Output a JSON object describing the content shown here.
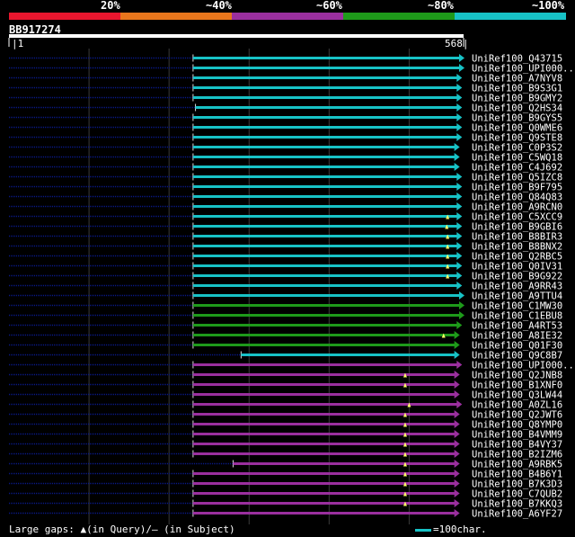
{
  "legend": {
    "labels": [
      "20%",
      "~40%",
      "~60%",
      "~80%",
      "~100%"
    ],
    "colors": [
      "#e8162e",
      "#e8761c",
      "#9a2f9e",
      "#1e9a1a",
      "#17c2c6"
    ]
  },
  "query": {
    "id": "BB917274",
    "start": "|1",
    "end": "568|",
    "length": 568
  },
  "footer": {
    "gaps_text": "Large gaps: ▲(in Query)/– (in Subject)",
    "scale_text": "=100char."
  },
  "colors": {
    "bg": "#000000",
    "query_bar": "#ffffff",
    "dotted_left": "#0a1a8a",
    "grid": "#3a3a3a",
    "cyan": "#17c2c6",
    "green": "#1e9a1a",
    "purple": "#9a2f9e",
    "gap_marker": "#ffff66"
  },
  "hits": [
    {
      "name": "UniRef100_Q43715",
      "color": "cyan",
      "start": 230,
      "end": 568,
      "gap": null
    },
    {
      "name": "UniRef100_UPI000..",
      "color": "cyan",
      "start": 230,
      "end": 568,
      "gap": null
    },
    {
      "name": "UniRef100_A7NYV8",
      "color": "cyan",
      "start": 230,
      "end": 565,
      "gap": null
    },
    {
      "name": "UniRef100_B9S3G1",
      "color": "cyan",
      "start": 230,
      "end": 565,
      "gap": null
    },
    {
      "name": "UniRef100_B9GMY2",
      "color": "cyan",
      "start": 230,
      "end": 565,
      "gap": null
    },
    {
      "name": "UniRef100_Q2HS34",
      "color": "cyan",
      "start": 233,
      "end": 565,
      "gap": null
    },
    {
      "name": "UniRef100_B9GYS5",
      "color": "cyan",
      "start": 230,
      "end": 565,
      "gap": null
    },
    {
      "name": "UniRef100_Q0WME6",
      "color": "cyan",
      "start": 230,
      "end": 565,
      "gap": null
    },
    {
      "name": "UniRef100_Q9STE8",
      "color": "cyan",
      "start": 230,
      "end": 565,
      "gap": null
    },
    {
      "name": "UniRef100_C0P3S2",
      "color": "cyan",
      "start": 230,
      "end": 562,
      "gap": null
    },
    {
      "name": "UniRef100_C5WQ18",
      "color": "cyan",
      "start": 230,
      "end": 562,
      "gap": null
    },
    {
      "name": "UniRef100_C4J692",
      "color": "cyan",
      "start": 230,
      "end": 562,
      "gap": null
    },
    {
      "name": "UniRef100_Q5IZC8",
      "color": "cyan",
      "start": 230,
      "end": 565,
      "gap": null
    },
    {
      "name": "UniRef100_B9F795",
      "color": "cyan",
      "start": 230,
      "end": 565,
      "gap": null
    },
    {
      "name": "UniRef100_Q84Q83",
      "color": "cyan",
      "start": 230,
      "end": 565,
      "gap": null
    },
    {
      "name": "UniRef100_A9RCN0",
      "color": "cyan",
      "start": 230,
      "end": 565,
      "gap": null
    },
    {
      "name": "UniRef100_C5XCC9",
      "color": "cyan",
      "start": 230,
      "end": 565,
      "gap": 548
    },
    {
      "name": "UniRef100_B9GBI6",
      "color": "cyan",
      "start": 230,
      "end": 565,
      "gap": 547
    },
    {
      "name": "UniRef100_B8BIR3",
      "color": "cyan",
      "start": 230,
      "end": 565,
      "gap": 548
    },
    {
      "name": "UniRef100_B8BNX2",
      "color": "cyan",
      "start": 230,
      "end": 565,
      "gap": 548
    },
    {
      "name": "UniRef100_Q2RBC5",
      "color": "cyan",
      "start": 230,
      "end": 565,
      "gap": 548
    },
    {
      "name": "UniRef100_Q0IV31",
      "color": "cyan",
      "start": 230,
      "end": 565,
      "gap": 548
    },
    {
      "name": "UniRef100_B9G922",
      "color": "cyan",
      "start": 230,
      "end": 565,
      "gap": 548
    },
    {
      "name": "UniRef100_A9RR43",
      "color": "cyan",
      "start": 230,
      "end": 565,
      "gap": null
    },
    {
      "name": "UniRef100_A9TTU4",
      "color": "cyan",
      "start": 230,
      "end": 568,
      "gap": null
    },
    {
      "name": "UniRef100_C1MW30",
      "color": "green",
      "start": 230,
      "end": 568,
      "gap": null
    },
    {
      "name": "UniRef100_C1EBU8",
      "color": "green",
      "start": 230,
      "end": 568,
      "gap": null
    },
    {
      "name": "UniRef100_A4RT53",
      "color": "green",
      "start": 230,
      "end": 565,
      "gap": null
    },
    {
      "name": "UniRef100_A8IE32",
      "color": "green",
      "start": 230,
      "end": 562,
      "gap": 543
    },
    {
      "name": "UniRef100_Q01F30",
      "color": "green",
      "start": 230,
      "end": 562,
      "gap": null
    },
    {
      "name": "UniRef100_Q9C8B7",
      "color": "cyan",
      "start": 290,
      "end": 562,
      "gap": null
    },
    {
      "name": "UniRef100_UPI000..",
      "color": "purple",
      "start": 230,
      "end": 565,
      "gap": null
    },
    {
      "name": "UniRef100_Q2JNB8",
      "color": "purple",
      "start": 230,
      "end": 562,
      "gap": 495
    },
    {
      "name": "UniRef100_B1XNF0",
      "color": "purple",
      "start": 230,
      "end": 562,
      "gap": 495
    },
    {
      "name": "UniRef100_Q3LW44",
      "color": "purple",
      "start": 230,
      "end": 562,
      "gap": null
    },
    {
      "name": "UniRef100_A0ZL16",
      "color": "purple",
      "start": 230,
      "end": 565,
      "gap": 500
    },
    {
      "name": "UniRef100_Q2JWT6",
      "color": "purple",
      "start": 230,
      "end": 562,
      "gap": 495
    },
    {
      "name": "UniRef100_Q8YMP0",
      "color": "purple",
      "start": 230,
      "end": 562,
      "gap": 495
    },
    {
      "name": "UniRef100_B4VMM9",
      "color": "purple",
      "start": 230,
      "end": 562,
      "gap": 495
    },
    {
      "name": "UniRef100_B4VY37",
      "color": "purple",
      "start": 230,
      "end": 562,
      "gap": 495
    },
    {
      "name": "UniRef100_B2IZM6",
      "color": "purple",
      "start": 230,
      "end": 562,
      "gap": 495
    },
    {
      "name": "UniRef100_A9RBK5",
      "color": "purple",
      "start": 280,
      "end": 562,
      "gap": 495
    },
    {
      "name": "UniRef100_B4B6Y1",
      "color": "purple",
      "start": 230,
      "end": 562,
      "gap": 495
    },
    {
      "name": "UniRef100_B7K3D3",
      "color": "purple",
      "start": 230,
      "end": 562,
      "gap": 495
    },
    {
      "name": "UniRef100_C7QUB2",
      "color": "purple",
      "start": 230,
      "end": 562,
      "gap": 495
    },
    {
      "name": "UniRef100_B7KKQ3",
      "color": "purple",
      "start": 230,
      "end": 562,
      "gap": 495
    },
    {
      "name": "UniRef100_A6YF27",
      "color": "purple",
      "start": 230,
      "end": 562,
      "gap": null
    }
  ]
}
